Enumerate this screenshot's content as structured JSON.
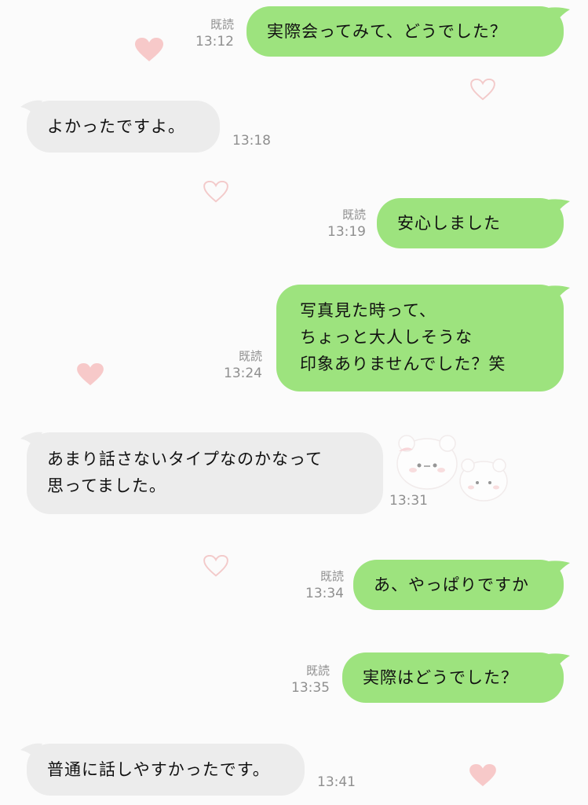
{
  "colors": {
    "outgoing_bubble": "#9de37e",
    "incoming_bubble": "#ececec",
    "timestamp": "#8f8f8f",
    "background": "#fbfbfb",
    "heart": "#f7c9c9"
  },
  "messages": [
    {
      "direction": "out",
      "text": "実際会ってみて、どうでした？",
      "read_label": "既読",
      "time": "13:12"
    },
    {
      "direction": "in",
      "text": "よかったですよ。",
      "time": "13:18"
    },
    {
      "direction": "out",
      "text": "安心しました",
      "read_label": "既読",
      "time": "13:19"
    },
    {
      "direction": "out",
      "text": "写真見た時って、\nちょっと大人しそうな\n印象ありませんでした？笑",
      "read_label": "既読",
      "time": "13:24"
    },
    {
      "direction": "in",
      "text": "あまり話さないタイプなのかなって\n思ってました。",
      "time": "13:31"
    },
    {
      "direction": "out",
      "text": "あ、やっぱりですか",
      "read_label": "既読",
      "time": "13:34"
    },
    {
      "direction": "out",
      "text": "実際はどうでした？",
      "read_label": "既読",
      "time": "13:35"
    },
    {
      "direction": "in",
      "text": "普通に話しやすかったです。",
      "time": "13:41"
    }
  ],
  "decorations": {
    "hearts": [
      "heart-icon",
      "heart-outline-icon"
    ],
    "sticker": "bear-sticker-icon"
  }
}
